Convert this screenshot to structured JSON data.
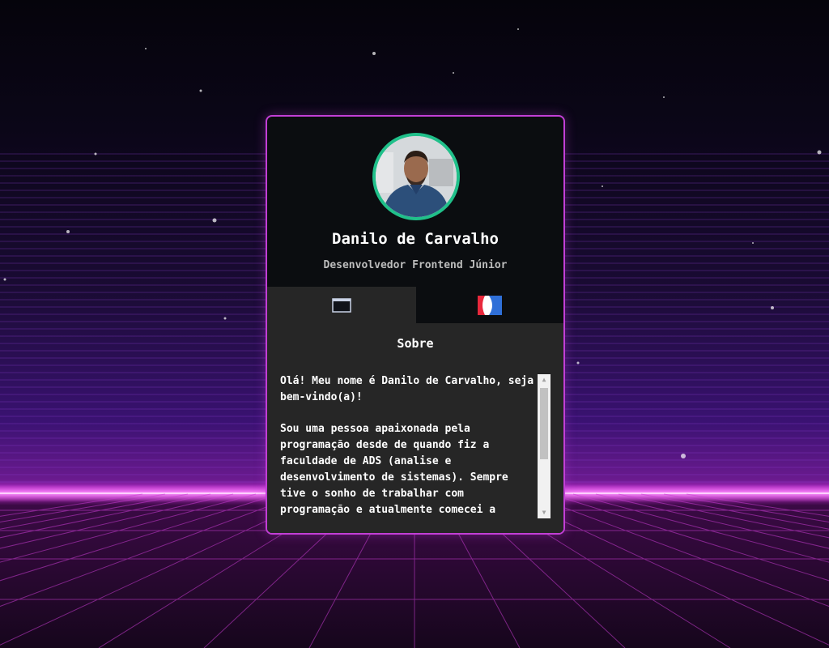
{
  "profile": {
    "name": "Danilo de Carvalho",
    "role": "Desenvolvedor Frontend Júnior",
    "avatar_alt": "avatar"
  },
  "tabs": [
    {
      "icon": "browser-window-icon",
      "active": true
    },
    {
      "icon": "projects-logo-icon",
      "active": false
    }
  ],
  "about": {
    "title": "Sobre",
    "paragraph1": "Olá! Meu nome é Danilo de Carvalho, seja bem-vindo(a)!",
    "paragraph2": "Sou uma pessoa apaixonada pela programação desde de quando fiz a faculdade de ADS (analise e desenvolvimento de sistemas). Sempre tive o sonho de trabalhar com programação e atualmente comecei a"
  },
  "colors": {
    "accent_border": "#c23fd6",
    "avatar_ring": "#20c08a",
    "card_bg": "#0b0d10",
    "panel_bg": "#262626"
  }
}
